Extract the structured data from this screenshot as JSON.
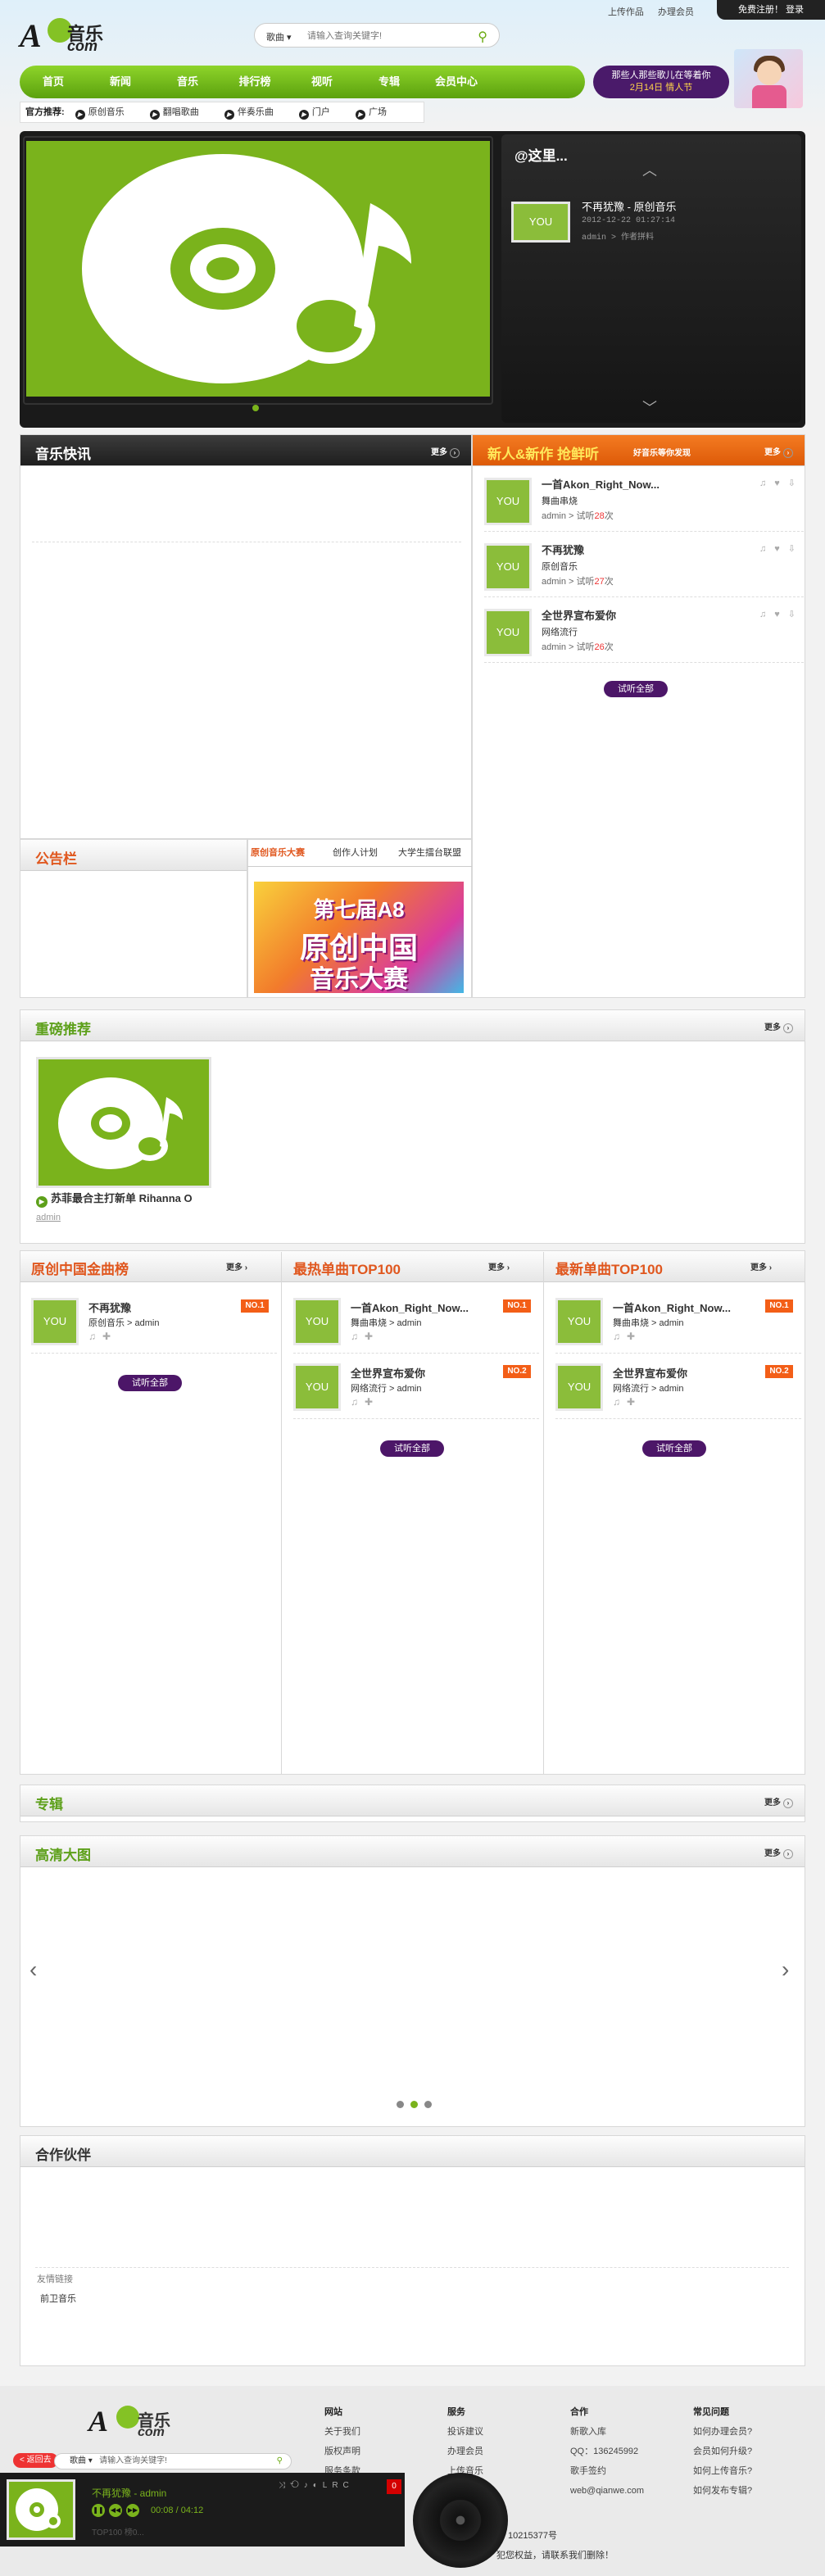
{
  "header": {
    "top_links": [
      "上传作品",
      "办理会员"
    ],
    "register": "免费注册！ 登录",
    "logo_a": "A",
    "logo_text": "音乐",
    "logo_com": "com",
    "search_cat": "歌曲",
    "search_placeholder": "请输入查询关键字!",
    "nav": [
      "首页",
      "新闻",
      "音乐",
      "排行榜",
      "视听",
      "专辑",
      "会员中心"
    ],
    "promo_line1": "那些人那些歌儿在等着你",
    "promo_line2": "2月14日 情人节",
    "official_label": "官方推荐:",
    "official_items": [
      "原创音乐",
      "翻唱歌曲",
      "伴奏乐曲",
      "门户",
      "广场"
    ]
  },
  "banner": {
    "side_title": "@这里...",
    "song_title": "不再犹豫 - 原创音乐",
    "song_time": "2012-12-22 01:27:14",
    "song_meta": "admin > 作者拼料",
    "thumb": "YOU"
  },
  "news": {
    "title": "音乐快讯",
    "more": "更多"
  },
  "fresh": {
    "title": "新人&新作 抢鲜听",
    "sub": "好音乐等你发现",
    "more": "更多",
    "songs": [
      {
        "name": "一首Akon_Right_Now...",
        "singer": "舞曲串烧",
        "by": "admin > 试听",
        "plays": "28",
        "unit": "次"
      },
      {
        "name": "不再犹豫",
        "singer": "原创音乐",
        "by": "admin > 试听",
        "plays": "27",
        "unit": "次"
      },
      {
        "name": "全世界宣布爱你",
        "singer": "网络流行",
        "by": "admin > 试听",
        "plays": "26",
        "unit": "次"
      }
    ],
    "listen_all": "试听全部"
  },
  "notice": {
    "title": "公告栏"
  },
  "tabs": [
    "原创音乐大赛",
    "创作人计划",
    "大学生擂台联盟"
  ],
  "competition": {
    "line1": "第七届A8",
    "line2": "原创中国",
    "line3": "音乐大赛"
  },
  "featured": {
    "title": "重磅推荐",
    "more": "更多",
    "caption": "苏菲最合主打新单 Rihanna O",
    "by": "admin"
  },
  "charts": [
    {
      "title": "原创中国金曲榜",
      "more": "更多",
      "songs": [
        {
          "name": "不再犹豫",
          "singer": "原创音乐 > admin",
          "no": "NO.1"
        }
      ],
      "listen_all": "试听全部"
    },
    {
      "title": "最热单曲TOP100",
      "more": "更多",
      "songs": [
        {
          "name": "一首Akon_Right_Now...",
          "singer": "舞曲串烧 > admin",
          "no": "NO.1"
        },
        {
          "name": "全世界宣布爱你",
          "singer": "网络流行 > admin",
          "no": "NO.2"
        }
      ],
      "listen_all": "试听全部"
    },
    {
      "title": "最新单曲TOP100",
      "more": "更多",
      "songs": [
        {
          "name": "一首Akon_Right_Now...",
          "singer": "舞曲串烧 > admin",
          "no": "NO.1"
        },
        {
          "name": "全世界宣布爱你",
          "singer": "网络流行 > admin",
          "no": "NO.2"
        }
      ],
      "listen_all": "试听全部"
    }
  ],
  "album": {
    "title": "专辑",
    "more": "更多"
  },
  "hd": {
    "title": "高清大图",
    "more": "更多"
  },
  "partners": {
    "title": "合作伙伴",
    "links_label": "友情链接",
    "link": "前卫音乐"
  },
  "footer": {
    "cols": [
      {
        "title": "网站",
        "items": [
          "关于我们",
          "版权声明",
          "服务条款"
        ]
      },
      {
        "title": "服务",
        "items": [
          "投诉建议",
          "办理会员",
          "上传音乐"
        ]
      },
      {
        "title": "合作",
        "items": [
          "新歌入库",
          "QQ：136245992",
          "歌手签约",
          "web@qianwe.com"
        ]
      },
      {
        "title": "常见问题",
        "items": [
          "如何办理会员?",
          "会员如何升级?",
          "如何上传音乐?",
          "如何发布专辑?"
        ]
      }
    ],
    "back": "< 返回去",
    "icp": "10215377号",
    "notice": "犯您权益，请联系我们删除！"
  },
  "player": {
    "now": "不再犹豫 - admin",
    "time": "00:08 / 04:12",
    "list": "TOP100 榜0...",
    "count": "0",
    "tools": "LRC"
  }
}
